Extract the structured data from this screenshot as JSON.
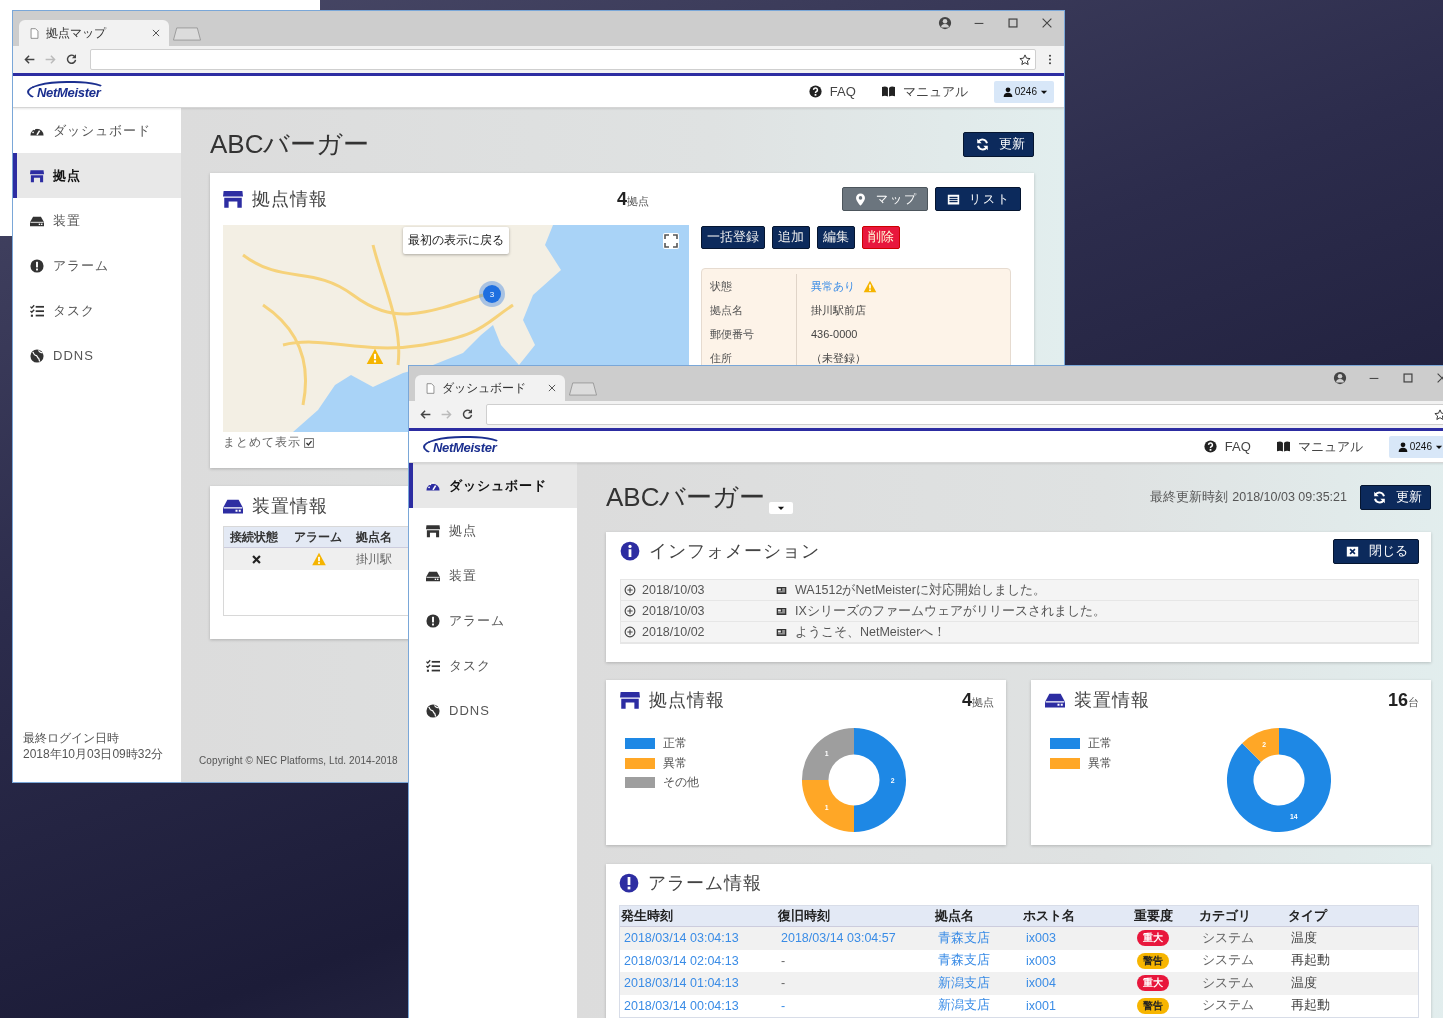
{
  "windows": [
    {
      "kind": "site_map",
      "tab": {
        "title": "拠点マップ"
      },
      "header": {
        "logo": "NetMeister",
        "links": [
          {
            "kind": "faq",
            "label": "FAQ"
          },
          {
            "kind": "manual",
            "label": "マニュアル"
          }
        ],
        "user": "0246"
      },
      "sidebar": {
        "items": [
          {
            "kind": "dashboard",
            "label": "ダッシュボード",
            "selected": false
          },
          {
            "kind": "site",
            "label": "拠点",
            "selected": true
          },
          {
            "kind": "device",
            "label": "装置",
            "selected": false
          },
          {
            "kind": "alarm",
            "label": "アラーム",
            "selected": false
          },
          {
            "kind": "task",
            "label": "タスク",
            "selected": false
          },
          {
            "kind": "ddns",
            "label": "DDNS",
            "selected": false
          }
        ],
        "last_login_label": "最終ログイン日時",
        "last_login": "2018年10月03日09時32分"
      },
      "page_title": "ABCバーガー",
      "refresh_button": "更新",
      "site_card": {
        "title": "拠点情報",
        "count": "4",
        "unit": "拠点",
        "view_buttons": [
          {
            "kind": "map",
            "label": "マップ",
            "selected": true
          },
          {
            "kind": "list",
            "label": "リスト",
            "selected": false
          }
        ],
        "map": {
          "reset_button": "最初の表示に戻る",
          "cluster_count": "3"
        },
        "group_toggle": {
          "label": "まとめて表示",
          "checked": true
        },
        "actions": [
          {
            "kind": "normal",
            "label": "一括登録"
          },
          {
            "kind": "normal",
            "label": "追加"
          },
          {
            "kind": "normal",
            "label": "編集"
          },
          {
            "kind": "danger",
            "label": "削除"
          }
        ],
        "details": [
          {
            "kind": "status",
            "label": "状態",
            "value": "異常あり"
          },
          {
            "kind": "text",
            "label": "拠点名",
            "value": "掛川駅前店"
          },
          {
            "kind": "text",
            "label": "郵便番号",
            "value": "436-0000"
          },
          {
            "kind": "text",
            "label": "住所",
            "value": "（未登録）"
          }
        ]
      },
      "device_card": {
        "title": "装置情報",
        "columns": [
          "接続状態",
          "アラーム",
          "拠点名"
        ],
        "rows": [
          {
            "connected": false,
            "alarm": true,
            "site": "掛川駅"
          }
        ]
      },
      "copyright": "Copyright © NEC Platforms, Ltd. 2014-2018"
    },
    {
      "kind": "dashboard",
      "tab": {
        "title": "ダッシュボード"
      },
      "header": {
        "logo": "NetMeister",
        "links": [
          {
            "kind": "faq",
            "label": "FAQ"
          },
          {
            "kind": "manual",
            "label": "マニュアル"
          }
        ],
        "user": "0246"
      },
      "sidebar": {
        "items": [
          {
            "kind": "dashboard",
            "label": "ダッシュボード",
            "selected": true
          },
          {
            "kind": "site",
            "label": "拠点",
            "selected": false
          },
          {
            "kind": "device",
            "label": "装置",
            "selected": false
          },
          {
            "kind": "alarm",
            "label": "アラーム",
            "selected": false
          },
          {
            "kind": "task",
            "label": "タスク",
            "selected": false
          },
          {
            "kind": "ddns",
            "label": "DDNS",
            "selected": false
          }
        ]
      },
      "page_title": "ABCバーガー",
      "last_updated_label": "最終更新時刻",
      "last_updated": "2018/10/03 09:35:21",
      "refresh_button": "更新",
      "info_card": {
        "title": "インフォメーション",
        "close_button": "閉じる",
        "items": [
          {
            "date": "2018/10/03",
            "message": "WA1512がNetMeisterに対応開始しました。"
          },
          {
            "date": "2018/10/03",
            "message": "IXシリーズのファームウェアがリリースされました。"
          },
          {
            "date": "2018/10/02",
            "message": "ようこそ、NetMeisterへ！"
          }
        ]
      },
      "site_card": {
        "title": "拠点情報",
        "count": "4",
        "unit": "拠点",
        "legend": [
          {
            "color": "#1e88e5"
          },
          {
            "color": "#ffa726"
          },
          {
            "color": "#9e9e9e"
          }
        ],
        "chart_data": {
          "type": "donut",
          "categories": [
            "正常",
            "異常",
            "その他"
          ],
          "values": [
            2,
            1,
            1
          ],
          "legend": "left",
          "data_labels": true
        }
      },
      "device_card": {
        "title": "装置情報",
        "count": "16",
        "unit": "台",
        "legend": [
          {
            "color": "#1e88e5"
          },
          {
            "color": "#ffa726"
          }
        ],
        "chart_data": {
          "type": "donut",
          "categories": [
            "正常",
            "異常"
          ],
          "values": [
            14,
            2
          ],
          "legend": "left",
          "data_labels": true
        }
      },
      "alarm_card": {
        "title": "アラーム情報",
        "columns": [
          "発生時刻",
          "復旧時刻",
          "拠点名",
          "ホスト名",
          "重要度",
          "カテゴリ",
          "タイプ"
        ],
        "rows": [
          {
            "occurred": "2018/03/14 03:04:13",
            "recovered": "2018/03/14 03:04:57",
            "recovered_link": true,
            "site": "青森支店",
            "host": "ix003",
            "severity": {
              "kind": "critical",
              "label": "重大"
            },
            "category": "システム",
            "type": "温度"
          },
          {
            "occurred": "2018/03/14 02:04:13",
            "recovered": "-",
            "recovered_link": false,
            "site": "青森支店",
            "host": "ix003",
            "severity": {
              "kind": "warning",
              "label": "警告"
            },
            "category": "システム",
            "type": "再起動"
          },
          {
            "occurred": "2018/03/14 01:04:13",
            "recovered": "-",
            "recovered_link": false,
            "site": "新潟支店",
            "host": "ix004",
            "severity": {
              "kind": "critical",
              "label": "重大"
            },
            "category": "システム",
            "type": "温度"
          },
          {
            "occurred": "2018/03/14 00:04:13",
            "recovered": "-",
            "recovered_link": true,
            "site": "新潟支店",
            "host": "ix001",
            "severity": {
              "kind": "warning",
              "label": "警告"
            },
            "category": "システム",
            "type": "再起動"
          }
        ]
      }
    }
  ]
}
